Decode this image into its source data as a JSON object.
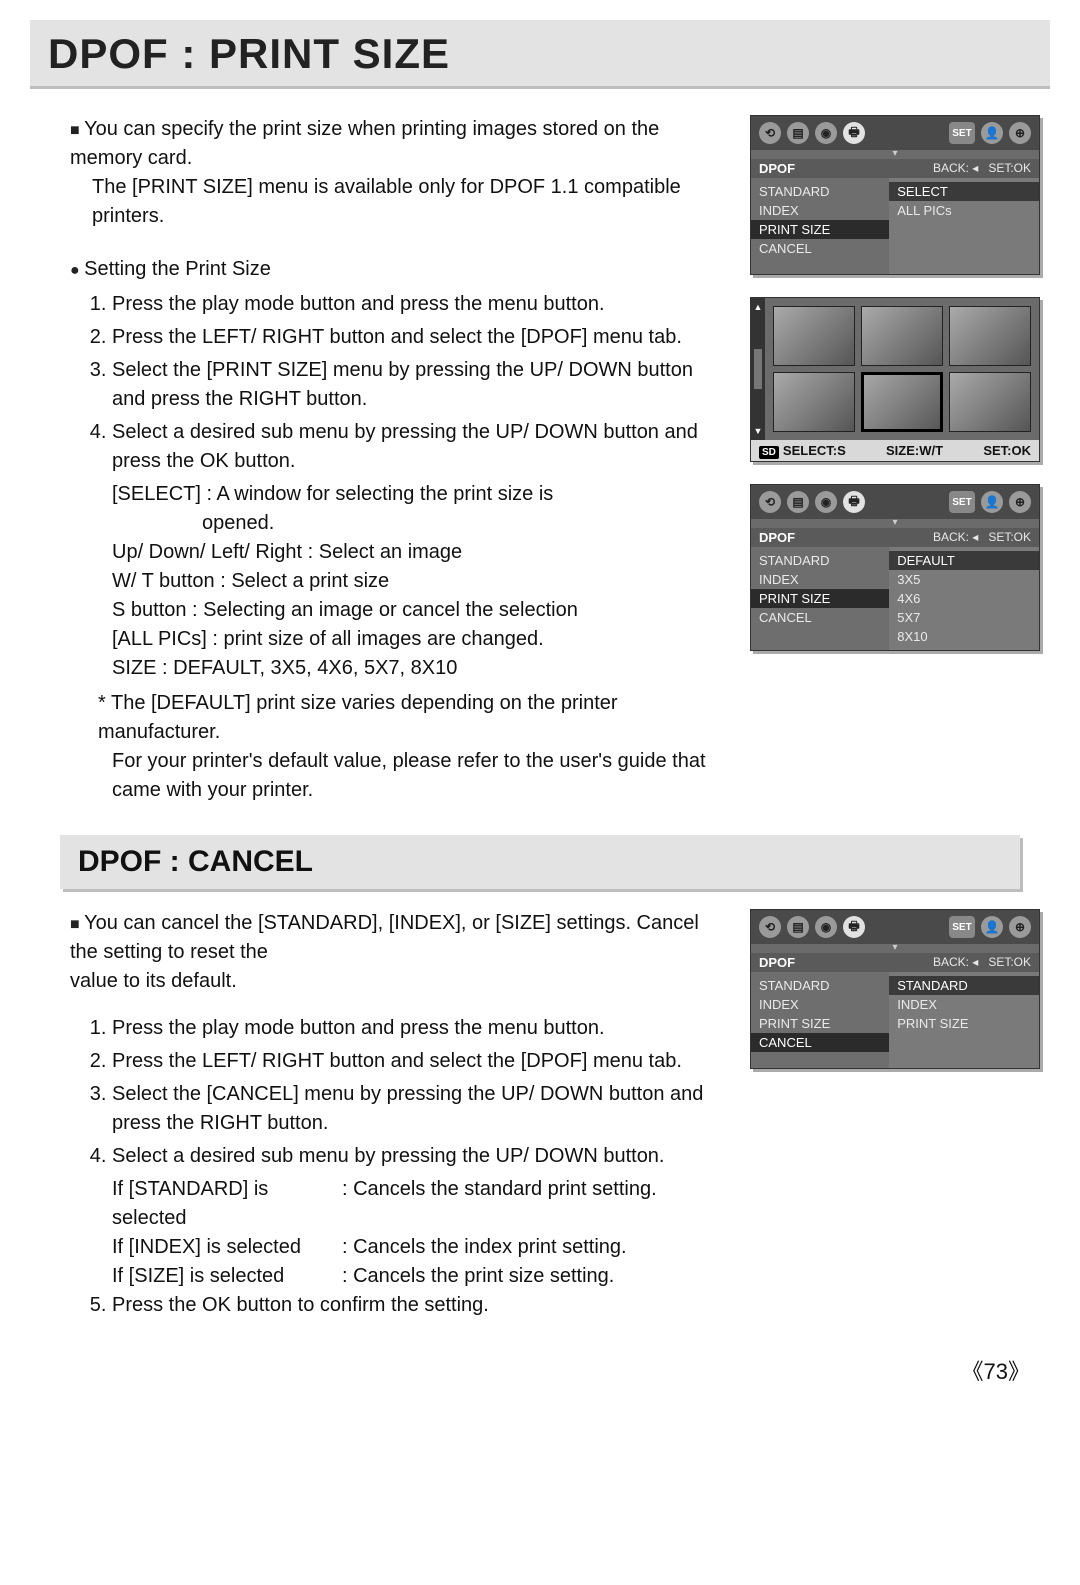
{
  "page": {
    "title": "DPOF : PRINT SIZE",
    "intro_line1": "You can specify the print size when printing images stored on the memory card.",
    "intro_line2": "The [PRINT SIZE] menu is available only for DPOF 1.1 compatible printers.",
    "section_head": "Setting the Print Size",
    "steps": {
      "s1": "Press the play mode button and press the menu button.",
      "s2": "Press the LEFT/ RIGHT button and select the [DPOF] menu tab.",
      "s3": "Select the [PRINT SIZE] menu by pressing the UP/ DOWN button and press the RIGHT button.",
      "s4": "Select a desired sub menu by pressing the UP/ DOWN button and press the OK button."
    },
    "sub": {
      "select_label": "[SELECT] : A window for selecting the print size is",
      "select_label2": "opened.",
      "udlr": "Up/ Down/ Left/ Right : Select an image",
      "wt": "W/ T button : Select a print size",
      "sbtn": "S button : Selecting an image or cancel the selection",
      "allpics": "[ALL PICs] : print size of all images are changed.",
      "size": "SIZE : DEFAULT, 3X5, 4X6, 5X7, 8X10"
    },
    "note1": "* The [DEFAULT] print size varies depending on the printer manufacturer.",
    "note2": "For your printer's default value, please refer to the user's guide that came with your printer."
  },
  "lcd1": {
    "title": "DPOF",
    "back": "BACK:",
    "setok": "SET:OK",
    "left": [
      "STANDARD",
      "INDEX",
      "PRINT SIZE",
      "CANCEL"
    ],
    "left_selected_index": 2,
    "right": [
      "SELECT",
      "ALL PICs"
    ],
    "right_selected_index": 0,
    "icon_set": "SET"
  },
  "lcd2": {
    "foot_select": "SELECT:S",
    "foot_size": "SIZE:W/T",
    "foot_set": "SET:OK",
    "sd": "SD"
  },
  "lcd3": {
    "title": "DPOF",
    "back": "BACK:",
    "setok": "SET:OK",
    "left": [
      "STANDARD",
      "INDEX",
      "PRINT SIZE",
      "CANCEL"
    ],
    "left_selected_index": 2,
    "right": [
      "DEFAULT",
      "3X5",
      "4X6",
      "5X7",
      "8X10"
    ],
    "right_selected_index": 0
  },
  "section2": {
    "title": "DPOF : CANCEL",
    "intro1": "You can cancel the [STANDARD], [INDEX], or [SIZE] settings. Cancel the setting to reset the",
    "intro2": "value to its default.",
    "steps": {
      "s1": "Press the play mode button and press the menu button.",
      "s2": "Press the LEFT/ RIGHT button and select the [DPOF] menu tab.",
      "s3": "Select the [CANCEL] menu by pressing the UP/ DOWN button and press the RIGHT button.",
      "s4": "Select a desired sub menu by pressing the UP/ DOWN button."
    },
    "if_std_k": "If [STANDARD] is selected",
    "if_std_v": ": Cancels the standard print setting.",
    "if_idx_k": "If [INDEX] is selected",
    "if_idx_v": ": Cancels the index print setting.",
    "if_siz_k": "If [SIZE] is selected",
    "if_siz_v": ": Cancels the print size setting.",
    "s5": "Press the OK button to confirm the setting."
  },
  "lcd4": {
    "title": "DPOF",
    "back": "BACK:",
    "setok": "SET:OK",
    "left": [
      "STANDARD",
      "INDEX",
      "PRINT SIZE",
      "CANCEL"
    ],
    "left_selected_index": 3,
    "right": [
      "STANDARD",
      "INDEX",
      "PRINT SIZE"
    ],
    "right_selected_index": 0
  },
  "page_number": "73"
}
